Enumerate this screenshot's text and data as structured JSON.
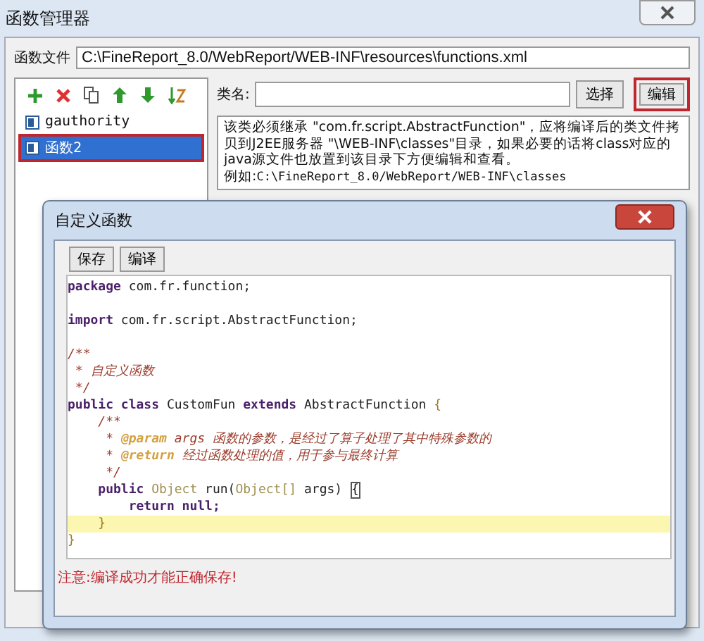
{
  "window": {
    "title": "函数管理器"
  },
  "function_file": {
    "label": "函数文件",
    "value": "C:\\FineReport_8.0/WebReport/WEB-INF\\resources\\functions.xml"
  },
  "functions": [
    {
      "name": "gauthority",
      "selected": false,
      "annotated": false
    },
    {
      "name": "函数2",
      "selected": true,
      "annotated": true
    }
  ],
  "class_name": {
    "label": "类名:",
    "buttons": [
      {
        "label": "选择",
        "annotated": false
      },
      {
        "label": "编辑",
        "annotated": true
      }
    ]
  },
  "description": {
    "text": "该类必须继承 \"com.fr.script.AbstractFunction\"，应将编译后的类文件拷贝到J2EE服务器 \"\\WEB-INF\\classes\"目录，如果必要的话将class对应的java源文件也放置到该目录下方便编辑和查看。",
    "example_label": "例如:",
    "example_path": "C:\\FineReport_8.0/WebReport/WEB-INF\\classes"
  },
  "dialog": {
    "title": "自定义函数",
    "buttons": [
      "保存",
      "编译"
    ],
    "code_lines": [
      {
        "kind": "code",
        "highlighted": false,
        "tokens": [
          {
            "kind": "kw",
            "text": "package"
          },
          {
            "kind": "plain",
            "text": " com.fr.function;"
          }
        ]
      },
      {
        "kind": "blank",
        "highlighted": false
      },
      {
        "kind": "code",
        "highlighted": false,
        "tokens": [
          {
            "kind": "kw",
            "text": "import"
          },
          {
            "kind": "plain",
            "text": " com.fr.script.AbstractFunction;"
          }
        ]
      },
      {
        "kind": "blank",
        "highlighted": false
      },
      {
        "kind": "code",
        "highlighted": false,
        "tokens": [
          {
            "kind": "comment",
            "text": "/**"
          }
        ]
      },
      {
        "kind": "code",
        "highlighted": false,
        "tokens": [
          {
            "kind": "comment",
            "text": " * 自定义函数"
          }
        ]
      },
      {
        "kind": "code",
        "highlighted": false,
        "tokens": [
          {
            "kind": "comment",
            "text": " */"
          }
        ]
      },
      {
        "kind": "code",
        "highlighted": false,
        "tokens": [
          {
            "kind": "kw",
            "text": "public class"
          },
          {
            "kind": "plain",
            "text": " CustomFun "
          },
          {
            "kind": "kw",
            "text": "extends"
          },
          {
            "kind": "plain",
            "text": " AbstractFunction "
          },
          {
            "kind": "brace",
            "text": "{"
          }
        ]
      },
      {
        "kind": "code",
        "highlighted": false,
        "tokens": [
          {
            "kind": "comment",
            "text": "    /**"
          }
        ]
      },
      {
        "kind": "code",
        "highlighted": false,
        "tokens": [
          {
            "kind": "comment",
            "text": "     * "
          },
          {
            "kind": "tag",
            "text": "@param"
          },
          {
            "kind": "comment",
            "text": " args 函数的参数，是经过了算子处理了其中特殊参数的"
          }
        ]
      },
      {
        "kind": "code",
        "highlighted": false,
        "tokens": [
          {
            "kind": "comment",
            "text": "     * "
          },
          {
            "kind": "tag",
            "text": "@return"
          },
          {
            "kind": "comment",
            "text": " 经过函数处理的值，用于参与最终计算"
          }
        ]
      },
      {
        "kind": "code",
        "highlighted": false,
        "tokens": [
          {
            "kind": "comment",
            "text": "     */"
          }
        ]
      },
      {
        "kind": "code",
        "highlighted": false,
        "tokens": [
          {
            "kind": "kw",
            "text": "    public"
          },
          {
            "kind": "type",
            "text": " Object"
          },
          {
            "kind": "plain",
            "text": " run("
          },
          {
            "kind": "type",
            "text": "Object[]"
          },
          {
            "kind": "plain",
            "text": " args) "
          },
          {
            "kind": "match",
            "text": "{"
          }
        ]
      },
      {
        "kind": "code",
        "highlighted": false,
        "tokens": [
          {
            "kind": "kw",
            "text": "        return null;"
          }
        ]
      },
      {
        "kind": "code",
        "highlighted": true,
        "tokens": [
          {
            "kind": "brace",
            "text": "    }"
          }
        ]
      },
      {
        "kind": "code",
        "highlighted": false,
        "tokens": [
          {
            "kind": "brace",
            "text": "}"
          }
        ]
      }
    ],
    "note": "注意:编译成功才能正确保存!"
  }
}
